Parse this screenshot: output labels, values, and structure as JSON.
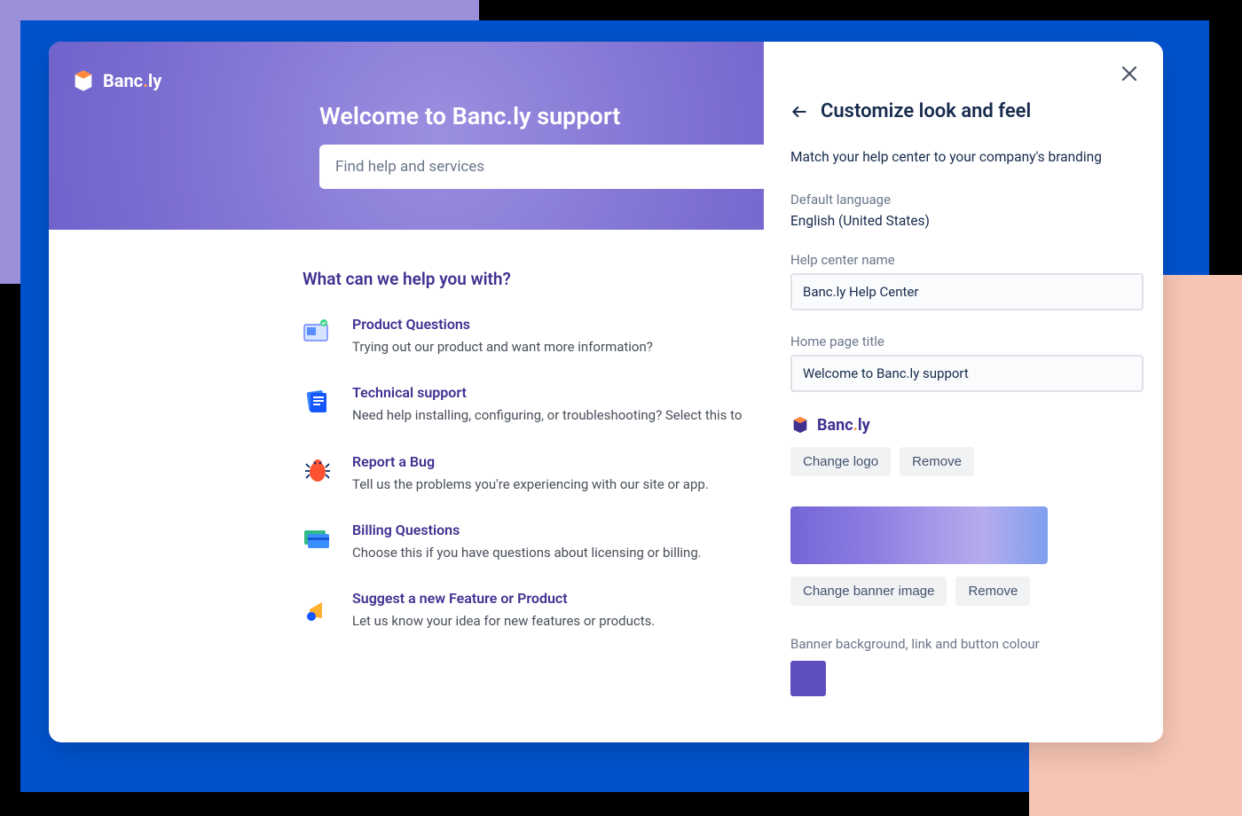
{
  "brand": {
    "name_part1": "Banc",
    "dot": ".",
    "name_part2": "ly"
  },
  "hero": {
    "title": "Welcome to Banc.ly support",
    "search_placeholder": "Find help and services"
  },
  "main": {
    "section_title": "What can we help you with?",
    "topics": [
      {
        "icon": "monitor-icon",
        "title": "Product Questions",
        "desc": "Trying out our product and want more information?"
      },
      {
        "icon": "doc-icon",
        "title": "Technical support",
        "desc": "Need help installing, configuring, or troubleshooting? Select this to"
      },
      {
        "icon": "bug-icon",
        "title": "Report a Bug",
        "desc": "Tell us the problems you're experiencing with our site or app."
      },
      {
        "icon": "card-icon",
        "title": "Billing Questions",
        "desc": "Choose this if you have questions about licensing or billing."
      },
      {
        "icon": "megaphone-icon",
        "title": "Suggest a new Feature or Product",
        "desc": "Let us know your idea for new features or products."
      }
    ]
  },
  "panel": {
    "title": "Customize look and feel",
    "subtitle": "Match your help center to your company's branding",
    "default_lang_label": "Default language",
    "default_lang_value": "English (United States)",
    "help_center_name_label": "Help center name",
    "help_center_name_value": "Banc.ly Help Center",
    "home_title_label": "Home page title",
    "home_title_value": "Welcome to Banc.ly support",
    "change_logo": "Change logo",
    "remove_logo": "Remove",
    "change_banner": "Change banner image",
    "remove_banner": "Remove",
    "banner_color_label": "Banner background, link and button colour",
    "banner_color": "#5d4fbf"
  }
}
